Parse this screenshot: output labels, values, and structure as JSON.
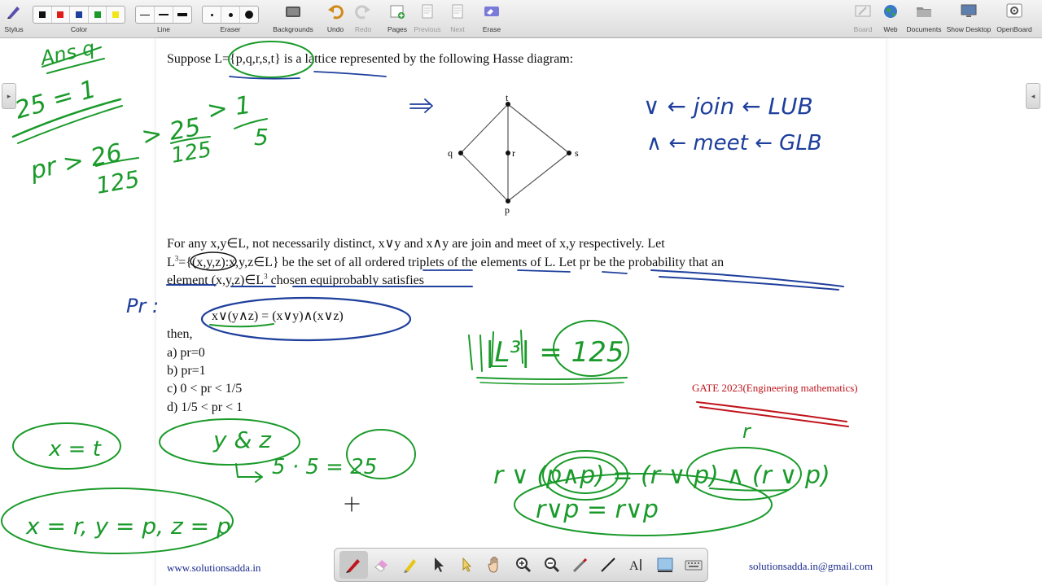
{
  "toolbar": {
    "stylus": "Stylus",
    "color": "Color",
    "line": "Line",
    "eraser": "Eraser",
    "backgrounds": "Backgrounds",
    "undo": "Undo",
    "redo": "Redo",
    "pages": "Pages",
    "previous": "Previous",
    "next": "Next",
    "erase": "Erase",
    "board": "Board",
    "web": "Web",
    "documents": "Documents",
    "show_desktop": "Show Desktop",
    "openboard": "OpenBoard",
    "colors": [
      "#111111",
      "#e01b1b",
      "#1e3f9c",
      "#1a9a2a",
      "#f2e61b"
    ]
  },
  "question": {
    "line1": "Suppose L={p,q,r,s,t} is a lattice represented by the following Hasse diagram:",
    "hasse_nodes": {
      "t": "t",
      "q": "q",
      "r": "r",
      "s": "s",
      "p": "p"
    },
    "para_line1": "For any x,y∈L, not necessarily distinct, x∨y and x∧y are join and meet of x,y respectively. Let",
    "para_line2_a": "L",
    "para_line2_sup": "3",
    "para_line2_b": "={(x,y,z):x,y,z∈L} be the set of all ordered triplets of the elements of L. Let pr be the probability that an",
    "para_line3_a": "element (x,y,z)∈L",
    "para_line3_sup": "3",
    "para_line3_b": " chosen equiprobably satisfies",
    "equation": "x∨(y∧z) = (x∨y)∧(x∨z)",
    "then": "then,",
    "options": [
      "a) pr=0",
      "b) pr=1",
      "c) 0 < pr < 1/5",
      "d) 1/5 < pr < 1"
    ]
  },
  "annotations": {
    "ans": "Ans q",
    "twentyfive": "25 = 1",
    "pr_ineq_a": "pr > 26",
    "pr_ineq_b": "125",
    "pr_ineq_c": "> 25",
    "pr_ineq_d": "125",
    "pr_ineq_e": "> 1",
    "pr_ineq_f": "5",
    "arrow": "=>",
    "join_note": "∨ ← join ← LUB",
    "meet_note": "∧ ← meet ← GLB",
    "pr_colon": "Pr :",
    "l3": "|L³| = 125",
    "x_eq_t": "x = t",
    "y_and_z": "y & z",
    "five_five": "5 · 5 = 25",
    "x_r_y_p_z_p": "x = r, y = p, z = p",
    "r_label": "r",
    "eq_left": "r ∨ (p∧p) = (r ∨ p) ∧ (r ∨ p)",
    "eq_bottom": "r∨p = r∨p"
  },
  "source_tag": "GATE 2023(Engineering mathematics)",
  "footer": {
    "website": "www.solutionsadda.in",
    "email": "solutionsadda.in@gmail.com"
  },
  "bottombar": {
    "tools": [
      "pen-tool",
      "eraser-tool",
      "highlighter-tool",
      "pointer-tool",
      "laser-tool",
      "hand-tool",
      "zoom-in-tool",
      "zoom-out-tool",
      "capture-tool",
      "line-tool",
      "text-tool",
      "screenshot-tool",
      "keyboard-tool"
    ]
  }
}
